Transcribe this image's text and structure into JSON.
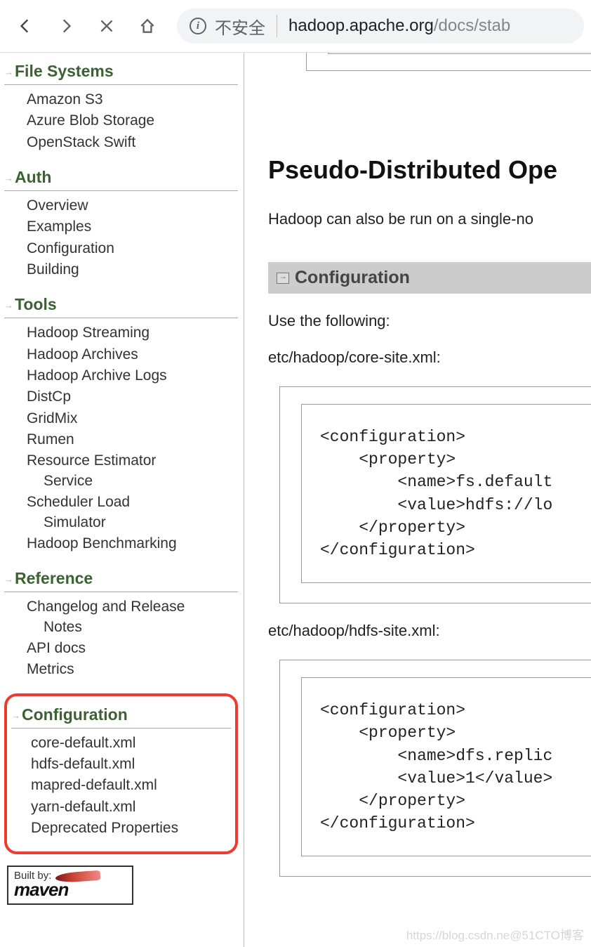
{
  "browser": {
    "site_status": "不安全",
    "url_host": "hadoop.apache.org",
    "url_path": "/docs/stab"
  },
  "sidebar": {
    "sections": [
      {
        "heading": "File Systems",
        "items": [
          "Amazon S3",
          "Azure Blob Storage",
          "OpenStack Swift"
        ]
      },
      {
        "heading": "Auth",
        "items": [
          "Overview",
          "Examples",
          "Configuration",
          "Building"
        ]
      },
      {
        "heading": "Tools",
        "items": [
          "Hadoop Streaming",
          "Hadoop Archives",
          "Hadoop Archive Logs",
          "DistCp",
          "GridMix",
          "Rumen",
          "Resource Estimator Service",
          "Scheduler Load Simulator",
          "Hadoop Benchmarking"
        ]
      },
      {
        "heading": "Reference",
        "items": [
          "Changelog and Release Notes",
          "API docs",
          "Metrics"
        ]
      },
      {
        "heading": "Configuration",
        "items": [
          "core-default.xml",
          "hdfs-default.xml",
          "mapred-default.xml",
          "yarn-default.xml",
          "Deprecated Properties"
        ]
      }
    ],
    "builtby_label": "Built by:",
    "builtby_brand": "maven"
  },
  "main": {
    "title": "Pseudo-Distributed Ope",
    "intro": "Hadoop can also be run on a single-no",
    "subheader": "Configuration",
    "use_following": "Use the following:",
    "file1_label": "etc/hadoop/core-site.xml:",
    "code1": "<configuration>\n    <property>\n        <name>fs.default\n        <value>hdfs://lo\n    </property>\n</configuration>",
    "file2_label": "etc/hadoop/hdfs-site.xml:",
    "code2": "<configuration>\n    <property>\n        <name>dfs.replic\n        <value>1</value>\n    </property>\n</configuration>"
  },
  "watermark": "https://blog.csdn.ne@51CTO博客"
}
